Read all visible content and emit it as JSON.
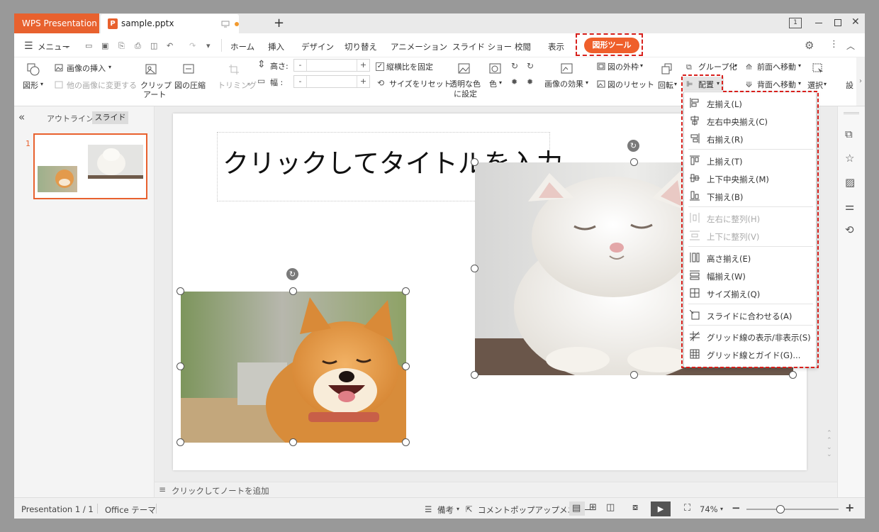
{
  "titlebar": {
    "app_tab": "WPS Presentation",
    "doc_tab": "sample.pptx",
    "new_tab": "+",
    "badge": "1"
  },
  "menu": {
    "menu_label": "メニュー",
    "tabs": [
      "ホーム",
      "挿入",
      "デザイン",
      "切り替え",
      "アニメーション",
      "スライド ショー",
      "校閲",
      "表示"
    ],
    "active_tab": "図形ツール"
  },
  "ribbon": {
    "shape": "図形",
    "insert_image": "画像の挿入",
    "change_image": "他の画像に変更する",
    "clipart_1": "クリップ",
    "clipart_2": "アート",
    "compress": "図の圧縮",
    "trim": "トリミング",
    "height_label": "高さ:",
    "width_label": "幅 :",
    "lock_ratio": "縦横比を固定",
    "reset_size": "サイズをリセット",
    "transparent_1": "透明な色",
    "transparent_2": "に設定",
    "color": "色",
    "effects": "画像の効果",
    "outline": "図の外枠",
    "reset_pic": "図のリセット",
    "rotate": "回転",
    "group": "グループ化",
    "arrange": "配置",
    "bring_forward": "前面へ移動",
    "send_backward": "背面へ移動",
    "select": "選択",
    "settings_cut": "設"
  },
  "panel": {
    "tab_outline": "アウトライン",
    "tab_slide": "スライド",
    "slide_number": "1"
  },
  "slide": {
    "title_placeholder": "クリックしてタイトルを入力"
  },
  "notes": {
    "placeholder": "クリックしてノートを追加"
  },
  "dropdown": {
    "items": [
      {
        "label": "左揃え(L)",
        "icon": "align-left-icon",
        "enabled": true
      },
      {
        "label": "左右中央揃え(C)",
        "icon": "align-center-icon",
        "enabled": true
      },
      {
        "label": "右揃え(R)",
        "icon": "align-right-icon",
        "enabled": true
      },
      {
        "label": "上揃え(T)",
        "icon": "align-top-icon",
        "enabled": true
      },
      {
        "label": "上下中央揃え(M)",
        "icon": "align-middle-icon",
        "enabled": true
      },
      {
        "label": "下揃え(B)",
        "icon": "align-bottom-icon",
        "enabled": true
      },
      {
        "label": "左右に整列(H)",
        "icon": "distribute-horizontal-icon",
        "enabled": false
      },
      {
        "label": "上下に整列(V)",
        "icon": "distribute-vertical-icon",
        "enabled": false
      },
      {
        "label": "高さ揃え(E)",
        "icon": "same-height-icon",
        "enabled": true
      },
      {
        "label": "幅揃え(W)",
        "icon": "same-width-icon",
        "enabled": true
      },
      {
        "label": "サイズ揃え(Q)",
        "icon": "same-size-icon",
        "enabled": true
      },
      {
        "label": "スライドに合わせる(A)",
        "icon": "fit-slide-icon",
        "enabled": true
      },
      {
        "label": "グリッド線の表示/非表示(S)",
        "icon": "toggle-gridlines-icon",
        "enabled": true
      },
      {
        "label": "グリッド線とガイド(G)...",
        "icon": "grid-guides-icon",
        "enabled": true
      }
    ]
  },
  "status": {
    "presentation": "Presentation 1 / 1",
    "theme": "Office テーマ",
    "notes_btn": "備考",
    "comment_btn": "コメントポップアップメニュー",
    "zoom": "74%",
    "zoom_minus": "−",
    "zoom_plus": "+",
    "zoom_fraction": 0.37
  },
  "colors": {
    "accent": "#e8612e",
    "active_tab": "#ef5f2b",
    "highlight": "#d8201c"
  }
}
